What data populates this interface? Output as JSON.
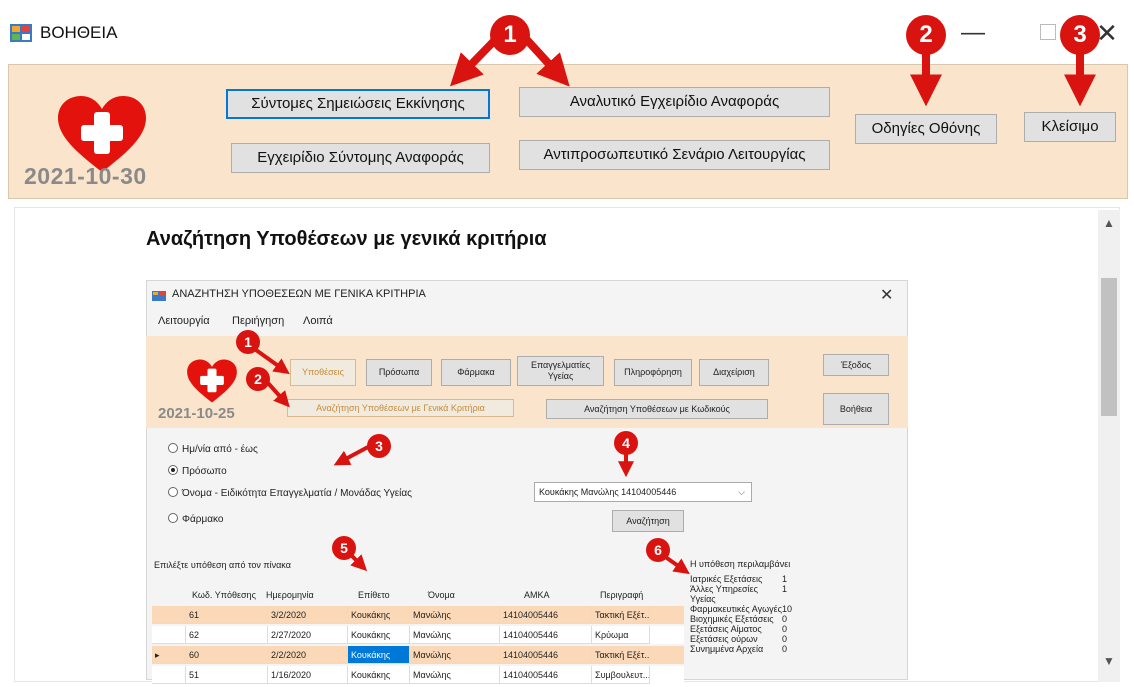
{
  "window": {
    "title": "ΒΟΗΘΕΙΑ",
    "minimize": "—",
    "close": "✕"
  },
  "toolbar": {
    "date": "2021-10-30",
    "btn_quick_notes": "Σύντομες Σημειώσεις Εκκίνησης",
    "btn_detailed_manual": "Αναλυτικό Εγχειρίδιο Αναφοράς",
    "btn_short_manual": "Εγχειρίδιο Σύντομης Αναφοράς",
    "btn_scenario": "Αντιπροσωπευτικό Σενάριο Λειτουργίας",
    "btn_screen_help": "Οδηγίες Οθόνης",
    "btn_close": "Κλείσιμο"
  },
  "markers": [
    "1",
    "2",
    "3"
  ],
  "content": {
    "heading": "Αναζήτηση Υποθέσεων με γενικά κριτήρια",
    "inner": {
      "title": "ΑΝΑΖΗΤΗΣΗ ΥΠΟΘΕΣΕΩΝ ΜΕ ΓΕΝΙΚΑ ΚΡΙΤΗΡΙΑ",
      "close": "✕",
      "menu": [
        "Λειτουργία",
        "Περιήγηση",
        "Λοιπά"
      ],
      "date": "2021-10-25",
      "buttons": {
        "cases": "Υποθέσεις",
        "persons": "Πρόσωπα",
        "drugs": "Φάρμακα",
        "professionals": "Επαγγελματίες Υγείας",
        "information": "Πληροφόρηση",
        "admin": "Διαχείριση",
        "exit": "Έξοδος",
        "search_general": "Αναζήτηση Υποθέσεων με Γενικά Κριτήρια",
        "search_codes": "Αναζήτηση Υποθέσεων με Κωδικούς",
        "help": "Βοήθεια",
        "search": "Αναζήτηση"
      },
      "radios": [
        "Ημ/νία από - έως",
        "Πρόσωπο",
        "Όνομα - Ειδικότητα Επαγγελματία / Μονάδας Υγείας",
        "Φάρμακο"
      ],
      "combo_value": "Κουκάκης Μανώλης 14104005446",
      "pick_label": "Επιλέξτε υπόθεση από τον πίνακα",
      "summary_label": "Η υπόθεση περιλαμβάνει",
      "grid_headers": [
        "Κωδ. Υπόθεσης",
        "Ημερομηνία",
        "Επίθετο",
        "Όνομα",
        "ΑΜΚΑ",
        "Περιγραφή"
      ],
      "grid_rows": [
        [
          "61",
          "3/2/2020",
          "Κουκάκης",
          "Μανώλης",
          "14104005446",
          "Τακτική Εξέτ..."
        ],
        [
          "62",
          "2/27/2020",
          "Κουκάκης",
          "Μανώλης",
          "14104005446",
          "Κρύωμα"
        ],
        [
          "60",
          "2/2/2020",
          "Κουκάκης",
          "Μανώλης",
          "14104005446",
          "Τακτική Εξέτ..."
        ],
        [
          "51",
          "1/16/2020",
          "Κουκάκης",
          "Μανώλης",
          "14104005446",
          "Συμβουλευτ..."
        ]
      ],
      "summary": [
        [
          "Ιατρικές Εξετάσεις",
          "1"
        ],
        [
          "Άλλες Υπηρεσίες Υγείας",
          "1"
        ],
        [
          "Φαρμακευτικές Αγωγές",
          "10"
        ],
        [
          "Βιοχημικές Εξετάσεις",
          "0"
        ],
        [
          "Εξετάσεις Αίματος",
          "0"
        ],
        [
          "Εξετάσεις ούρων",
          "0"
        ],
        [
          "Συνημμένα Αρχεία",
          "0"
        ]
      ],
      "markers": [
        "1",
        "2",
        "3",
        "4",
        "5",
        "6"
      ]
    }
  },
  "colors": {
    "panel": "#fae5cc",
    "accent_red": "#d9130f",
    "focus_blue": "#0078d7",
    "row_highlight": "#fbd9b8"
  }
}
